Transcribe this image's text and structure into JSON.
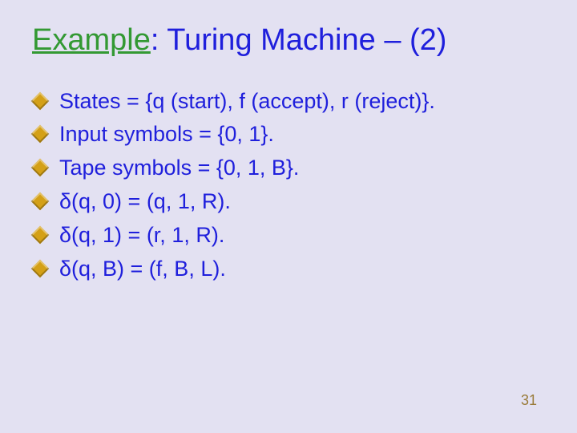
{
  "title": {
    "accent": "Example",
    "rest": ": Turing Machine – (2)"
  },
  "bullets": [
    "States = {q (start), f (accept), r (reject)}.",
    "Input symbols = {0, 1}.",
    "Tape symbols = {0, 1, B}.",
    "δ(q, 0) = (q, 1, R).",
    "δ(q, 1) = (r, 1, R).",
    "δ(q, B) = (f, B, L)."
  ],
  "page_number": "31"
}
